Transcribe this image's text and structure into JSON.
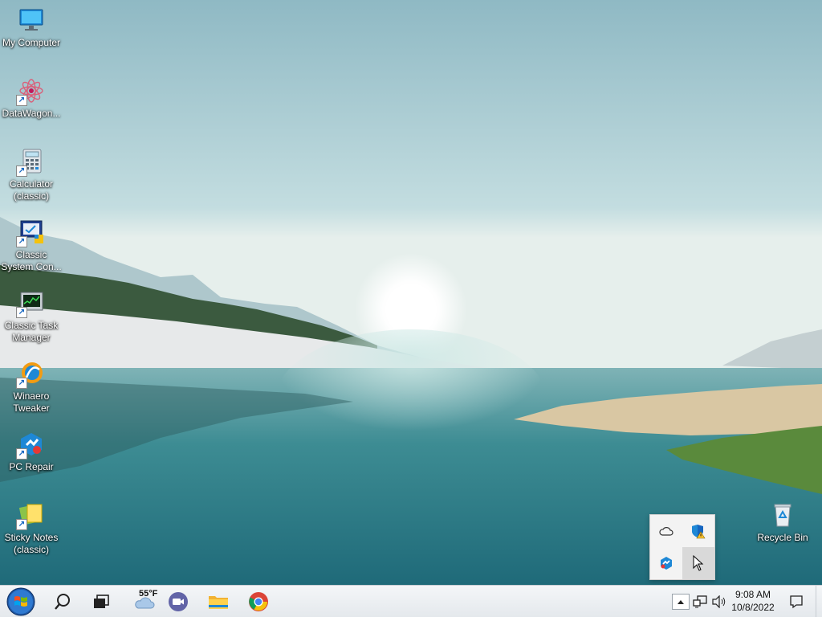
{
  "desktop": {
    "icons": [
      {
        "label": "My Computer",
        "icon": "monitor-icon"
      },
      {
        "label": "DataWagon...",
        "icon": "datawagon-flower-icon"
      },
      {
        "label": "Calculator\n(classic)",
        "icon": "calculator-icon"
      },
      {
        "label": "Classic\nSystem Con...",
        "icon": "system-config-icon"
      },
      {
        "label": "Classic Task\nManager",
        "icon": "task-manager-icon"
      },
      {
        "label": "Winaero\nTweaker",
        "icon": "winaero-tweaker-icon"
      },
      {
        "label": "PC Repair",
        "icon": "pc-repair-icon"
      },
      {
        "label": "Sticky Notes\n(classic)",
        "icon": "sticky-notes-icon"
      }
    ],
    "recycle_bin": {
      "label": "Recycle Bin",
      "icon": "recycle-bin-icon"
    }
  },
  "tray_popup": {
    "items": [
      "onedrive-cloud-icon",
      "security-warning-shield-icon",
      "repair-app-icon",
      "cursor-hover-slot"
    ]
  },
  "taskbar": {
    "start": "start-orb-icon",
    "search": "search-icon",
    "task_view": "task-view-icon",
    "weather": {
      "temp": "55°F",
      "icon": "weather-cloud-icon"
    },
    "apps": [
      "video-meeting-icon",
      "file-explorer-icon",
      "chrome-icon"
    ],
    "tray": {
      "overflow": "chevron-up-icon",
      "network": "network-icon",
      "volume": "volume-icon",
      "time": "9:08 AM",
      "date": "10/8/2022",
      "notifications": "notification-icon"
    }
  },
  "colors": {
    "sky_top": "#9fc4cc",
    "water": "#2f7c86",
    "taskbar": "#eef1f4"
  }
}
